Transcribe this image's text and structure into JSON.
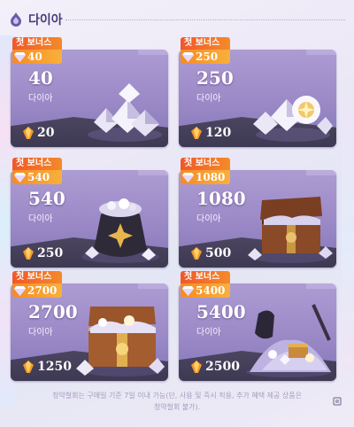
{
  "header": {
    "title": "다이아",
    "icon": "diamond-section-icon"
  },
  "badge_label": "첫 보너스",
  "unit_label": "다이아",
  "colors": {
    "card_purple": "#9a89c6",
    "badge_red": "#f0582a",
    "badge_orange": "#f8b03b",
    "header_text": "#4a3d76",
    "footer_text": "#a59cc0"
  },
  "products": [
    {
      "bonus": "40",
      "amount": "40",
      "unit": "다이아",
      "price": "20",
      "art": "diamond-pile-icon"
    },
    {
      "bonus": "250",
      "amount": "250",
      "unit": "다이아",
      "price": "120",
      "art": "diamond-pile-icon"
    },
    {
      "bonus": "540",
      "amount": "540",
      "unit": "다이아",
      "price": "250",
      "art": "diamond-pouch-icon"
    },
    {
      "bonus": "1080",
      "amount": "1080",
      "unit": "다이아",
      "price": "500",
      "art": "treasure-chest-icon"
    },
    {
      "bonus": "2700",
      "amount": "2700",
      "unit": "다이아",
      "price": "1250",
      "art": "treasure-chest-icon"
    },
    {
      "bonus": "5400",
      "amount": "5400",
      "unit": "다이아",
      "price": "2500",
      "art": "diamond-hoard-icon"
    }
  ],
  "footer": {
    "line1": "청약철회는 구매일 기준 7일 이내 가능(단, 사용 및 즉시 적용, 추가 혜택 제공 상품은",
    "line2": "청약철회 불가)."
  }
}
